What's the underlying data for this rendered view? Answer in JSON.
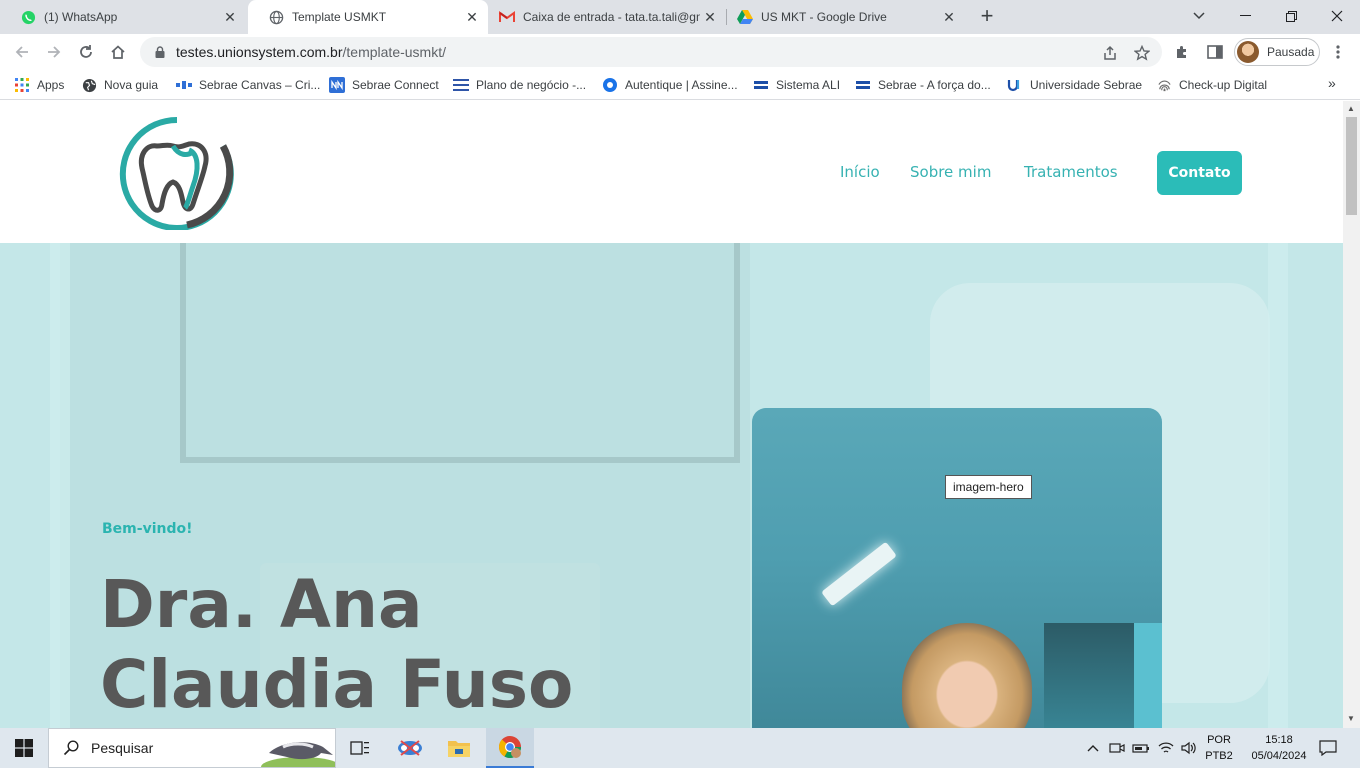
{
  "browser": {
    "tabs": [
      {
        "title": "(1) WhatsApp",
        "icon": "whatsapp-icon"
      },
      {
        "title": "Template USMKT",
        "icon": "globe-icon"
      },
      {
        "title": "Caixa de entrada - tata.ta.tali@gmail.com",
        "icon": "gmail-icon"
      },
      {
        "title": "US MKT - Google Drive",
        "icon": "google-drive-icon"
      }
    ],
    "address": {
      "host": "testes.unionsystem.com.br",
      "path": "/template-usmkt/"
    },
    "profile_label": "Pausada",
    "bookmarks": [
      {
        "label": "Apps",
        "icon": "apps-grid-icon"
      },
      {
        "label": "Nova guia",
        "icon": "globe-icon"
      },
      {
        "label": "Sebrae Canvas – Cri...",
        "icon": "sebrae-canvas-icon"
      },
      {
        "label": "Sebrae Connect",
        "icon": "sebrae-connect-icon"
      },
      {
        "label": "Plano de negócio -...",
        "icon": "plan-icon"
      },
      {
        "label": "Autentique | Assine...",
        "icon": "autentique-icon"
      },
      {
        "label": "Sistema ALI",
        "icon": "sebrae-icon"
      },
      {
        "label": "Sebrae - A força do...",
        "icon": "sebrae-icon"
      },
      {
        "label": "Universidade Sebrae",
        "icon": "universidade-icon"
      },
      {
        "label": "Check-up Digital",
        "icon": "fingerprint-icon"
      }
    ]
  },
  "site": {
    "nav": {
      "home": "Início",
      "about": "Sobre mim",
      "treatments": "Tratamentos",
      "contact": "Contato"
    },
    "hero": {
      "welcome": "Bem-vindo!",
      "title_line1": "Dra. Ana",
      "title_line2": "Claudia Fuso",
      "image_alt": "imagem-hero"
    },
    "colors": {
      "accent": "#2bbcb8",
      "title": "#585858",
      "hero_bg": "#c4e7e8"
    }
  },
  "taskbar": {
    "search_placeholder": "Pesquisar",
    "lang_line1": "POR",
    "lang_line2": "PTB2",
    "time": "15:18",
    "date": "05/04/2024"
  }
}
